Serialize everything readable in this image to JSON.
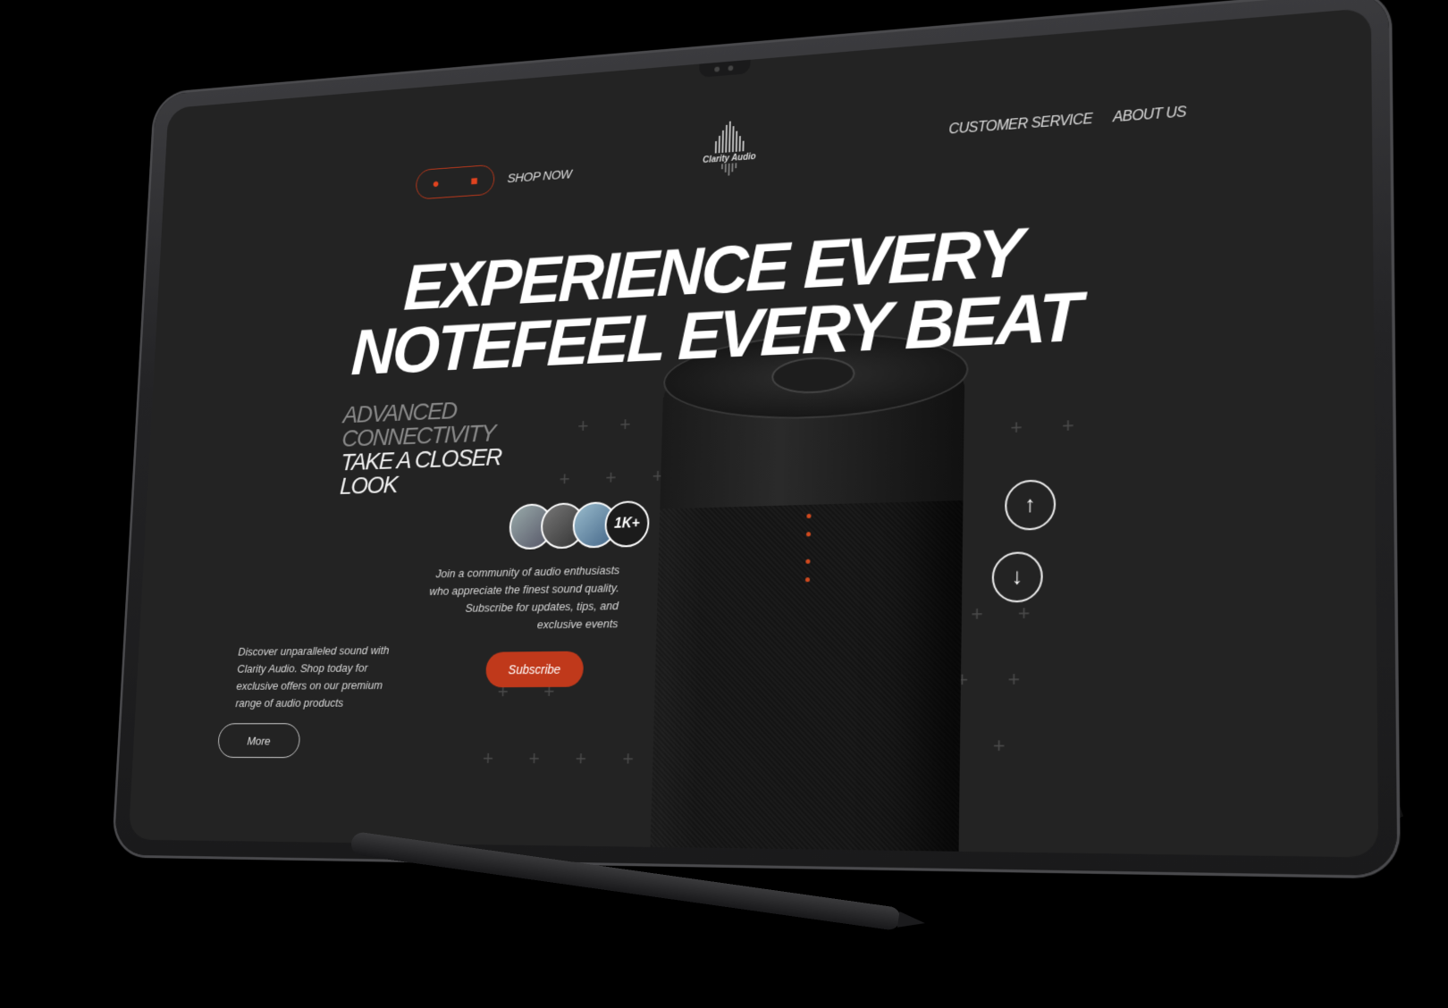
{
  "nav": {
    "shop_label": "SHOP NOW",
    "logo_name": "Clarity Audio",
    "links": [
      "CUSTOMER SERVICE",
      "ABOUT US"
    ],
    "user_icon": "user-icon",
    "bag_icon": "shopping-bag-icon"
  },
  "hero": {
    "line1": "EXPERIENCE EVERY",
    "line2": "NOTEFEEL EVERY BEAT"
  },
  "subheadline": {
    "line1": "ADVANCED",
    "line2": "CONNECTIVITY",
    "line3": "TAKE A CLOSER",
    "line4": "LOOK"
  },
  "community": {
    "count": "1K+",
    "text": "Join a community of audio enthusiasts who appreciate the finest sound quality. Subscribe for updates, tips, and exclusive events",
    "button": "Subscribe"
  },
  "promo": {
    "text": "Discover unparalleled sound with Clarity Audio. Shop today for exclusive offers on our premium range of audio products",
    "button": "More"
  },
  "colors": {
    "accent": "#c0391b",
    "background": "#232323"
  }
}
